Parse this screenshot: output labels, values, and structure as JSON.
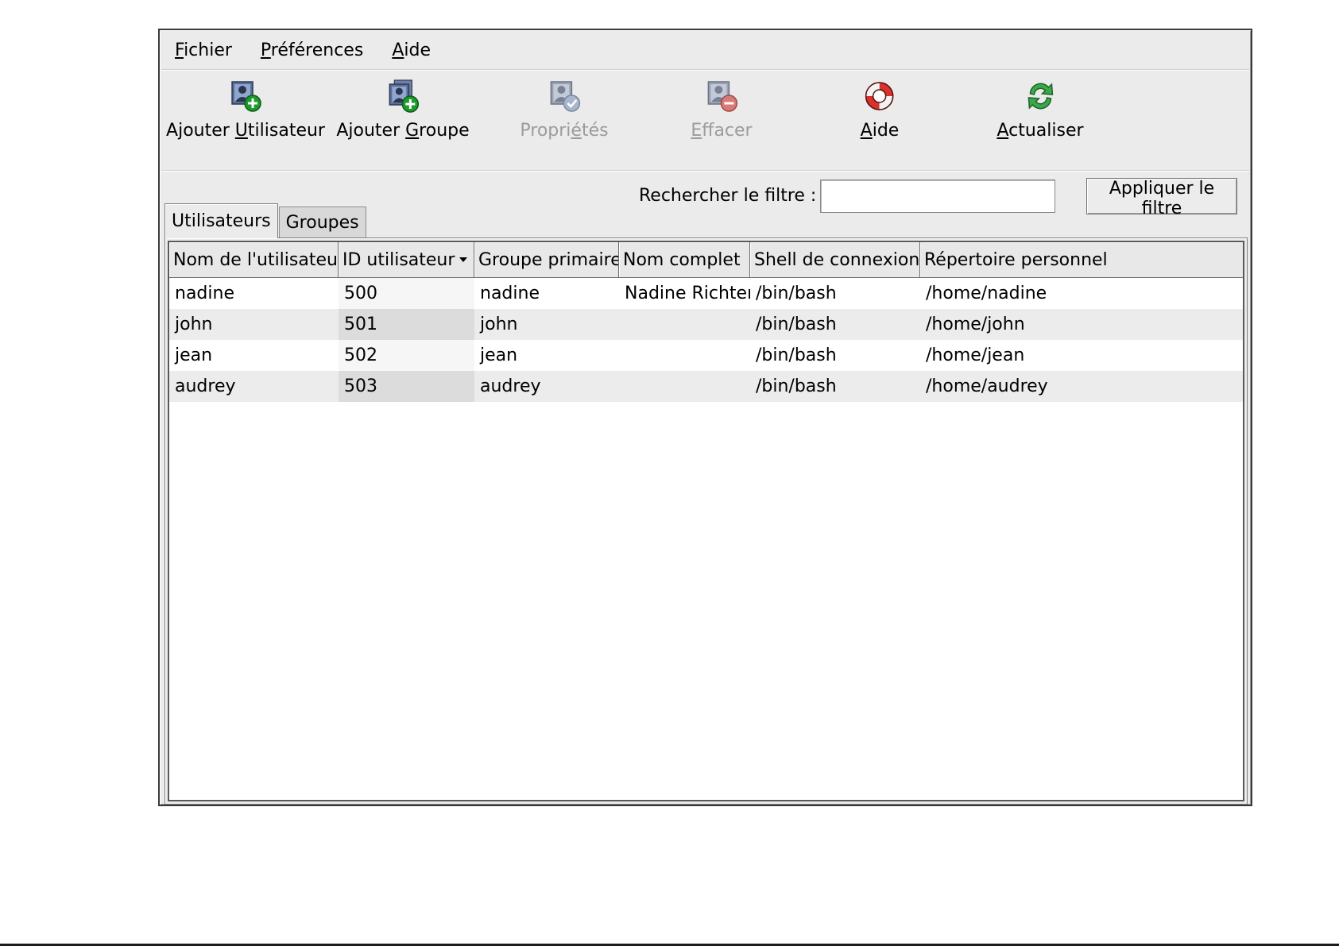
{
  "menubar": {
    "items": [
      {
        "pre": "",
        "mn": "F",
        "post": "ichier"
      },
      {
        "pre": "",
        "mn": "P",
        "post": "références"
      },
      {
        "pre": "",
        "mn": "A",
        "post": "ide"
      }
    ]
  },
  "toolbar": {
    "add_user": {
      "pre": "Ajouter ",
      "mn": "U",
      "post": "tilisateur",
      "icon": "add-user-icon"
    },
    "add_group": {
      "pre": "Ajouter ",
      "mn": "G",
      "post": "roupe",
      "icon": "add-group-icon"
    },
    "properties": {
      "pre": "Propri",
      "mn": "é",
      "post": "tés",
      "icon": "properties-icon",
      "disabled": true
    },
    "delete": {
      "pre": "",
      "mn": "E",
      "post": "ffacer",
      "icon": "delete-icon",
      "disabled": true
    },
    "help": {
      "pre": "",
      "mn": "A",
      "post": "ide",
      "icon": "lifebuoy-icon"
    },
    "refresh": {
      "pre": "",
      "mn": "A",
      "post": "ctualiser",
      "icon": "refresh-icon"
    }
  },
  "filter": {
    "label": "Rechercher le filtre :",
    "value": "",
    "button_label": "Appliquer le filtre"
  },
  "tabs": [
    {
      "label": "Utilisateurs",
      "active": true
    },
    {
      "label": "Groupes",
      "active": false
    }
  ],
  "table": {
    "columns": [
      "Nom de l'utilisateur",
      "ID utilisateur",
      "Groupe primaire",
      "Nom complet",
      "Shell de connexion",
      "Répertoire personnel"
    ],
    "sorted_column": 1,
    "rows": [
      [
        "nadine",
        "500",
        "nadine",
        "Nadine Richter",
        "/bin/bash",
        "/home/nadine"
      ],
      [
        "john",
        "501",
        "john",
        "",
        "/bin/bash",
        "/home/john"
      ],
      [
        "jean",
        "502",
        "jean",
        "",
        "/bin/bash",
        "/home/jean"
      ],
      [
        "audrey",
        "503",
        "audrey",
        "",
        "/bin/bash",
        "/home/audrey"
      ]
    ]
  },
  "colors": {
    "window_bg": "#ebebeb",
    "disabled_text": "#9c9c9c",
    "icon_green": "#1c9a2c",
    "icon_red": "#d8322c"
  }
}
